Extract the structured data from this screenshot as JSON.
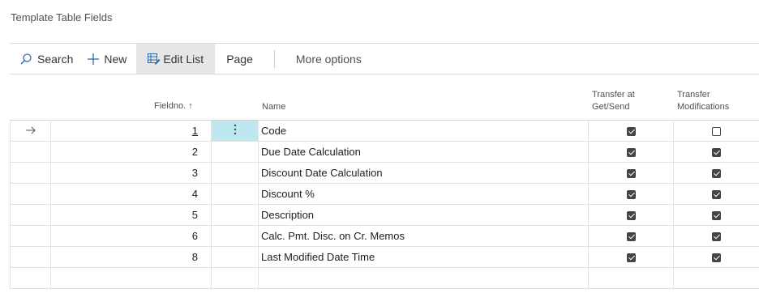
{
  "page": {
    "title": "Template Table Fields"
  },
  "actions": {
    "search": "Search",
    "new": "New",
    "edit_list": "Edit List",
    "page": "Page",
    "more_options": "More options"
  },
  "columns": {
    "fieldno": "Fieldno. ↑",
    "name": "Name",
    "transfer_line1": "Transfer at",
    "transfer_line2": "Get/Send",
    "mods_line1": "Transfer",
    "mods_line2": "Modifications"
  },
  "rows": [
    {
      "fieldno": "1",
      "name": "Code",
      "transfer": true,
      "mods": false
    },
    {
      "fieldno": "2",
      "name": "Due Date Calculation",
      "transfer": true,
      "mods": true
    },
    {
      "fieldno": "3",
      "name": "Discount Date Calculation",
      "transfer": true,
      "mods": true
    },
    {
      "fieldno": "4",
      "name": "Discount %",
      "transfer": true,
      "mods": true
    },
    {
      "fieldno": "5",
      "name": "Description",
      "transfer": true,
      "mods": true
    },
    {
      "fieldno": "6",
      "name": "Calc. Pmt. Disc. on Cr. Memos",
      "transfer": true,
      "mods": true
    },
    {
      "fieldno": "8",
      "name": "Last Modified Date Time",
      "transfer": true,
      "mods": true
    },
    {
      "fieldno": "",
      "name": "",
      "transfer": null,
      "mods": null
    }
  ],
  "icons": {
    "search": "search-icon",
    "new": "plus-icon",
    "edit_list": "edit-list-icon",
    "row_arrow": "arrow-right-icon",
    "row_menu": "more-vertical-icon"
  },
  "colors": {
    "selected_cell": "#bde8ef",
    "active_action": "#e6e6e6"
  }
}
